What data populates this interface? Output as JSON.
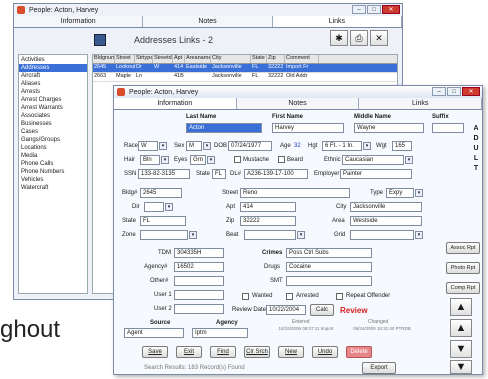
{
  "back_window": {
    "title": "People:   Acton, Harvey",
    "tabs": [
      "Information",
      "Notes",
      "Links"
    ],
    "links_title": "Addresses  Links - 2",
    "sidebar_items": [
      "Activities",
      "Addresses",
      "Aircraft",
      "Aliases",
      "Arrests",
      "Arrest Charges",
      "Arrest Warrants",
      "Associates",
      "Businesses",
      "Cases",
      "Gangs/Groups",
      "Locations",
      "Media",
      "Phone Calls",
      "Phone Numbers",
      "Vehicles",
      "Watercraft"
    ],
    "selected_sidebar_item": "Addresses",
    "grid_headers": [
      "Bldgnum",
      "Street",
      "Strtype",
      "Streetdir",
      "Apt",
      "Areaname",
      "City",
      "State",
      "Zip",
      "Comment"
    ],
    "grid_rows": [
      [
        "2645",
        "Lookout",
        "Dr",
        "W",
        "414",
        "Eastside",
        "Jacksonville",
        "FL",
        "32222",
        "Import Fr"
      ],
      [
        "2663",
        "Maple",
        "Ln",
        "",
        "41B",
        "",
        "Jacksonville",
        "FL",
        "32222",
        "Old Addr"
      ]
    ]
  },
  "front_window": {
    "title": "People:   Acton, Harvey",
    "tabs": [
      "Information",
      "Notes",
      "Links"
    ],
    "header_labels": {
      "last": "Last Name",
      "first": "First Name",
      "middle": "Middle Name",
      "suffix": "Suffix"
    },
    "name": {
      "last": "Acton",
      "first": "Harvey",
      "middle": "Wayne",
      "suffix": ""
    },
    "side_letters": [
      "A",
      "D",
      "U",
      "L",
      "T"
    ],
    "labels": {
      "race": "Race",
      "sex": "Sex",
      "dob": "DOB",
      "age": "Age",
      "hgt": "Hgt",
      "wgt": "Wgt",
      "hair": "Hair",
      "eyes": "Eyes",
      "mustache": "Mustache",
      "beard": "Beard",
      "ethnic": "Ethnic",
      "ssn": "SSN",
      "state": "State",
      "dl": "DL#",
      "employer": "Employer",
      "bldg": "Bldg#",
      "street": "Street",
      "type": "Type",
      "dir": "Dir",
      "apt": "Apt",
      "city": "City",
      "state2": "State",
      "zip": "Zip",
      "area": "Area",
      "zone": "Zone",
      "beat": "Beat",
      "grid": "Grid",
      "tdm": "TDM",
      "agency": "Agency#",
      "other": "Other#",
      "user1": "User 1",
      "user2": "User 2",
      "crimes": "Crimes",
      "drugs": "Drugs",
      "smt": "SMT",
      "wanted": "Wanted",
      "arrested": "Arrested",
      "repeat": "Repeat Offender",
      "review_date": "Review Date",
      "calc": "Calc",
      "review": "Review",
      "source": "Source",
      "agency2": "Agency",
      "entered": "Entered",
      "changed": "Changed"
    },
    "values": {
      "race": "W",
      "sex": "M",
      "dob": "07/24/1977",
      "age": "32",
      "hgt": "6 Ft. - 1 In.",
      "wgt": "165",
      "hair": "Bln",
      "eyes": "Grn",
      "ethnic": "Caucasian",
      "ssn": "133-82-3135",
      "state": "FL",
      "dl": "A236-139-17-100",
      "employer": "Painter",
      "bldg": "2645",
      "street": "Reno",
      "type": "Expy",
      "dir": "",
      "apt": "414",
      "city": "Jacksonville",
      "state2": "FL",
      "zip": "32222",
      "area": "Westside",
      "zone": "",
      "beat": "",
      "grid": "",
      "tdm": "304335H",
      "agency": "16502",
      "other": "",
      "user1": "",
      "user2": "",
      "crimes": "Poss Ctrl Subs",
      "drugs": "Cocaine",
      "smt": "",
      "review_date": "10/22/2004",
      "source": "Agent",
      "agency2": "Iptm",
      "entered": "10/19/2006 08:07:11  Import",
      "changed": "06/24/2009 15:31:40  PTRDB"
    },
    "buttons": [
      "Save",
      "Exit",
      "Find",
      "Clr Srch",
      "New",
      "Undo",
      "Delete"
    ],
    "status": "Search Results: 183 Record(s) Found",
    "export": "Export",
    "right_buttons": [
      "Assoc Rpt",
      "Photo Rpt",
      "Comp Rpt"
    ]
  },
  "background_text": "ghout"
}
